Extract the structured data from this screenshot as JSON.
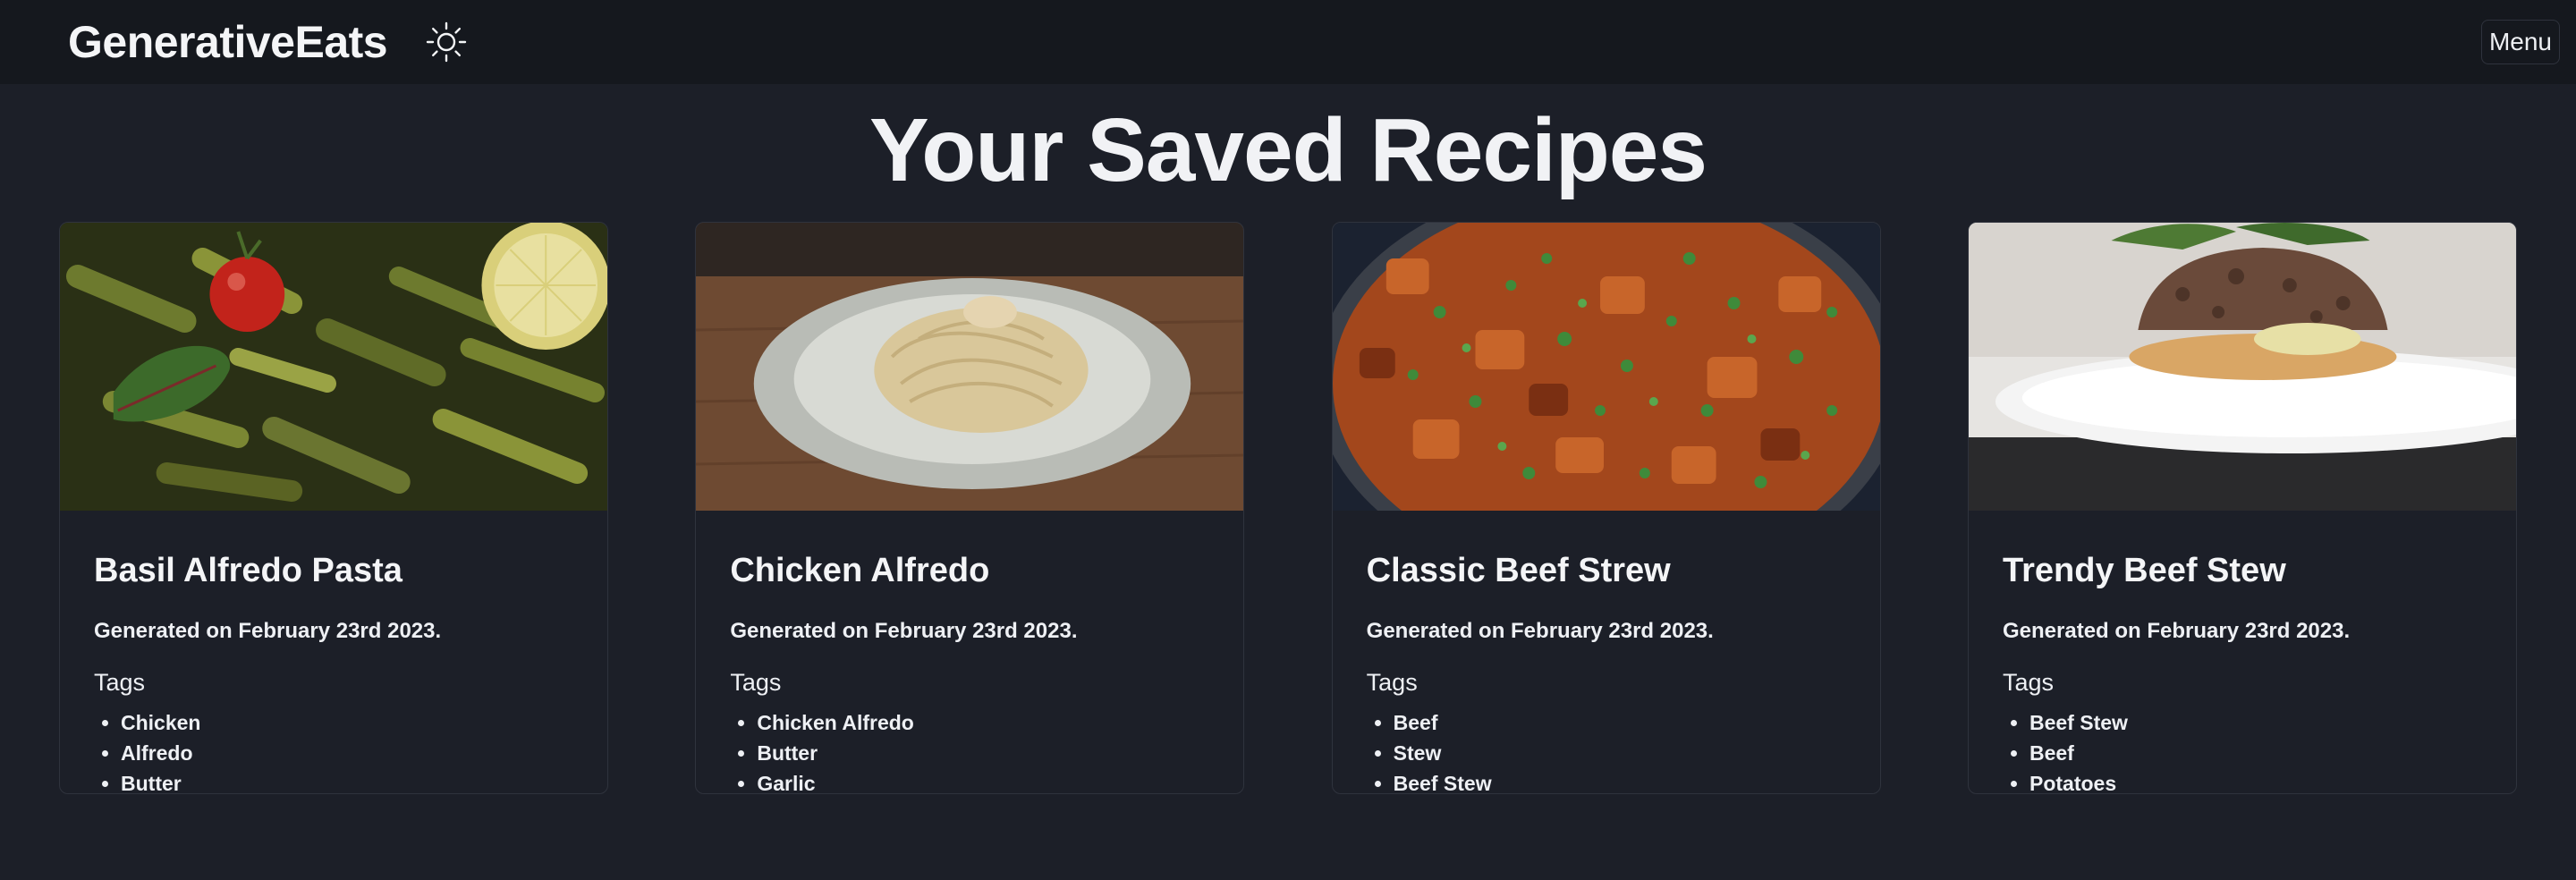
{
  "header": {
    "brand": "GenerativeEats",
    "theme_icon": "sun-icon",
    "menu_label": "Menu"
  },
  "page": {
    "title": "Your Saved Recipes"
  },
  "recipes": [
    {
      "title": "Basil Alfredo Pasta",
      "date": "Generated on February 23rd 2023.",
      "tags_label": "Tags",
      "tags": [
        "Chicken",
        "Alfredo",
        "Butter"
      ],
      "image": "pesto-pasta-photo"
    },
    {
      "title": "Chicken Alfredo",
      "date": "Generated on February 23rd 2023.",
      "tags_label": "Tags",
      "tags": [
        "Chicken Alfredo",
        "Butter",
        "Garlic"
      ],
      "image": "fettuccine-plate-photo"
    },
    {
      "title": "Classic Beef Strew",
      "date": "Generated on February 23rd 2023.",
      "tags_label": "Tags",
      "tags": [
        "Beef",
        "Stew",
        "Beef Stew"
      ],
      "image": "beef-stew-pot-photo"
    },
    {
      "title": "Trendy Beef Stew",
      "date": "Generated on February 23rd 2023.",
      "tags_label": "Tags",
      "tags": [
        "Beef Stew",
        "Beef",
        "Potatoes"
      ],
      "image": "burger-plate-photo"
    }
  ]
}
